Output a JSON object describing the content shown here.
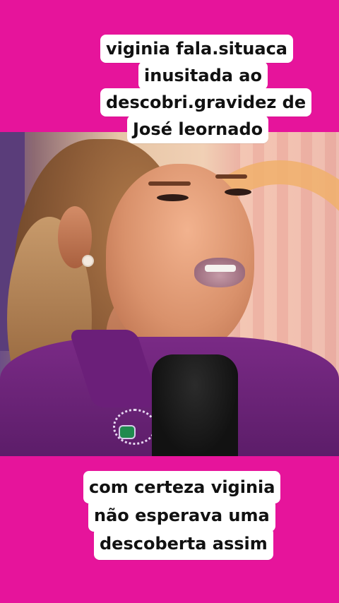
{
  "top_caption": {
    "lines": [
      "viginia fala.situaca",
      "inusitada ao",
      "descobri.gravidez de",
      "José leornado"
    ]
  },
  "bottom_caption": {
    "lines": [
      "com certeza viginia",
      "não esperava uma",
      "descoberta assim"
    ]
  },
  "colors": {
    "band": "#e6149b",
    "caption_bg": "#ffffff",
    "caption_text": "#111111"
  }
}
